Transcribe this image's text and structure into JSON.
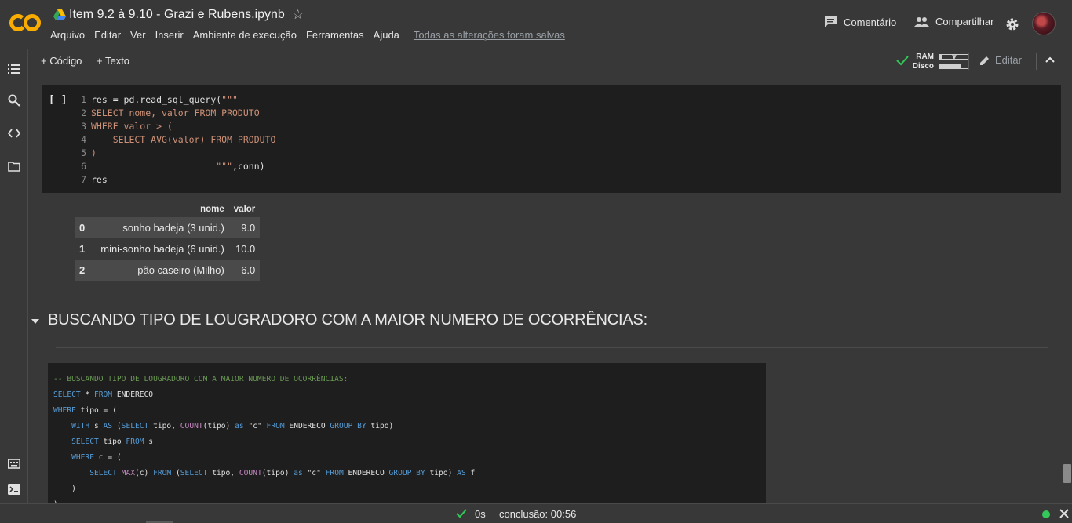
{
  "header": {
    "notebook_title": "Item 9.2 à 9.10 - Grazi e Rubens.ipynb",
    "menu": [
      "Arquivo",
      "Editar",
      "Ver",
      "Inserir",
      "Ambiente de execução",
      "Ferramentas",
      "Ajuda"
    ],
    "save_status": "Todas as alterações foram salvas",
    "comment_label": "Comentário",
    "share_label": "Compartilhar"
  },
  "toolbar": {
    "add_code": "+ Código",
    "add_text": "+ Texto",
    "ram_label": "RAM",
    "disk_label": "Disco",
    "ram_usage": 0.05,
    "disk_usage": 0.72,
    "edit_label": "Editar"
  },
  "code_cell": {
    "run_label": "[ ]",
    "lines": [
      {
        "n": "1",
        "a": "res = pd.read_sql_query(",
        "b": "\"\"\""
      },
      {
        "n": "2",
        "a": "",
        "b": "SELECT nome, valor FROM PRODUTO"
      },
      {
        "n": "3",
        "a": "",
        "b": "WHERE valor > ("
      },
      {
        "n": "4",
        "a": "",
        "b": "    SELECT AVG(valor) FROM PRODUTO"
      },
      {
        "n": "5",
        "a": "",
        "b": ")"
      },
      {
        "n": "6",
        "a": "",
        "b": "                       \"\"\"",
        "c": ",conn)"
      },
      {
        "n": "7",
        "a": "res",
        "b": ""
      }
    ]
  },
  "output_table": {
    "columns": [
      "",
      "nome",
      "valor"
    ],
    "rows": [
      {
        "idx": "0",
        "nome": "sonho badeja (3 unid.)",
        "valor": "9.0"
      },
      {
        "idx": "1",
        "nome": "mini-sonho badeja (6 unid.)",
        "valor": "10.0"
      },
      {
        "idx": "2",
        "nome": "pão caseiro (Milho)",
        "valor": "6.0"
      }
    ]
  },
  "section": {
    "title": "BUSCANDO TIPO DE LOUGRADORO COM A MAIOR NUMERO DE OCORRÊNCIAS:"
  },
  "sql_block": {
    "comment": "-- BUSCANDO TIPO DE LOUGRADORO COM A MAIOR NUMERO DE OCORRÊNCIAS:",
    "l1": {
      "k1": "SELECT",
      "t1": " * ",
      "k2": "FROM",
      "t2": " ENDERECO"
    },
    "l2": {
      "k1": "WHERE",
      "t1": " tipo = ("
    },
    "l3": {
      "pad": "    ",
      "k1": "WITH",
      "t1": " s ",
      "k2": "AS",
      "t2": " (",
      "k3": "SELECT",
      "t3": " tipo, ",
      "f1": "COUNT",
      "t4": "(tipo) ",
      "k4": "as",
      "t5": " \"c\" ",
      "k5": "FROM",
      "t6": " ENDERECO ",
      "k6": "GROUP BY",
      "t7": " tipo)"
    },
    "l4": {
      "pad": "    ",
      "k1": "SELECT",
      "t1": " tipo ",
      "k2": "FROM",
      "t2": " s"
    },
    "l5": {
      "pad": "    ",
      "k1": "WHERE",
      "t1": " c = ("
    },
    "l6": {
      "pad": "        ",
      "k1": "SELECT",
      "t1": " ",
      "f1": "MAX",
      "t2": "(c) ",
      "k2": "FROM",
      "t3": " (",
      "k3": "SELECT",
      "t4": " tipo, ",
      "f2": "COUNT",
      "t5": "(tipo) ",
      "k4": "as",
      "t6": " \"c\" ",
      "k5": "FROM",
      "t7": " ENDERECO ",
      "k6": "GROUP BY",
      "t8": " tipo) ",
      "k7": "AS",
      "t9": " f"
    },
    "l7": "    )",
    "l8": ")"
  },
  "statusbar": {
    "elapsed": "0s",
    "completion": "conclusão: 00:56"
  },
  "colors": {
    "background": "#383838",
    "code_bg": "#1e1e1e",
    "accent_orange": "#f9ab00",
    "success_green": "#34c759",
    "sql_keyword": "#569cd6",
    "sql_function": "#c586c0",
    "sql_comment": "#6a9955",
    "python_string": "#ce9178"
  },
  "icons": [
    "colab-logo",
    "drive-icon",
    "star-icon",
    "comment-icon",
    "share-people-icon",
    "gear-icon",
    "avatar",
    "toc-icon",
    "search-icon",
    "code-snippets-icon",
    "folder-icon",
    "command-palette-icon",
    "terminal-icon",
    "check-icon",
    "dropdown-arrow-icon",
    "pencil-icon",
    "collapse-chevron-icon",
    "section-arrow-icon",
    "close-icon"
  ]
}
